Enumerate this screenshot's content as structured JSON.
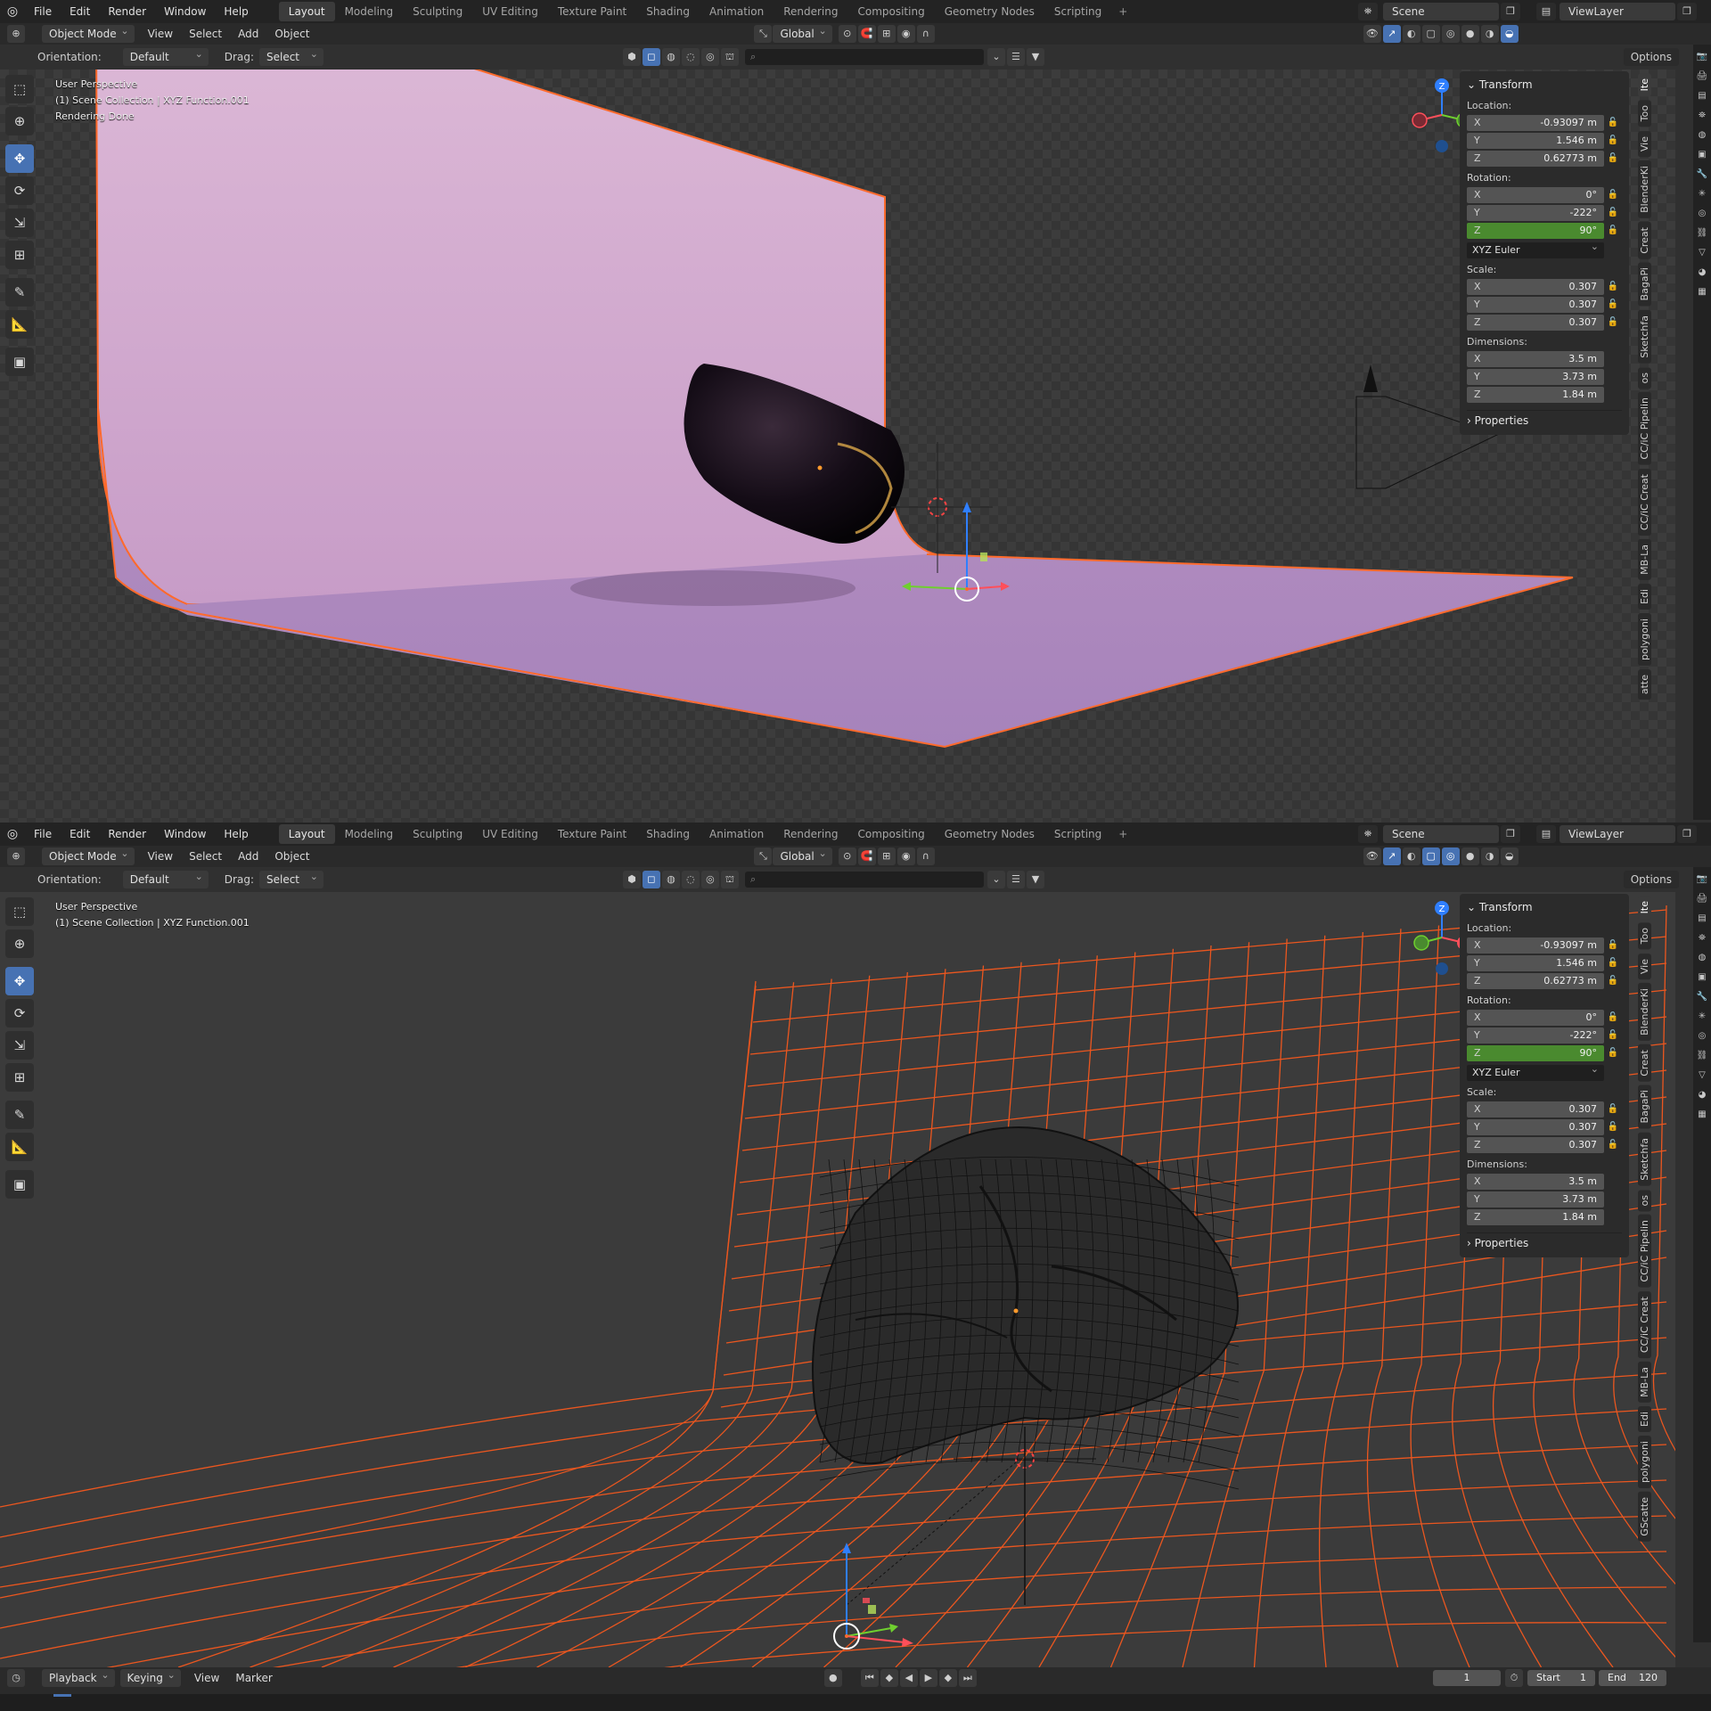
{
  "header": {
    "menus": [
      "File",
      "Edit",
      "Render",
      "Window",
      "Help"
    ],
    "workspaces": [
      "Layout",
      "Modeling",
      "Sculpting",
      "UV Editing",
      "Texture Paint",
      "Shading",
      "Animation",
      "Rendering",
      "Compositing",
      "Geometry Nodes",
      "Scripting"
    ],
    "add_tab": "+",
    "scene": "Scene",
    "view_layer": "ViewLayer"
  },
  "editor_header": {
    "mode": "Object Mode",
    "menus": [
      "View",
      "Select",
      "Add",
      "Object"
    ],
    "transform_orientation": "Global"
  },
  "tool_settings": {
    "orientation_label": "Orientation:",
    "orientation_value": "Default",
    "drag_label": "Drag:",
    "drag_value": "Select Box",
    "options": "Options"
  },
  "viewport_top": {
    "info": [
      "User Perspective",
      "(1) Scene Collection | XYZ Function.001",
      "Rendering Done"
    ]
  },
  "viewport_bottom": {
    "info": [
      "User Perspective",
      "(1) Scene Collection | XYZ Function.001"
    ]
  },
  "gizmo_axes": {
    "x": "X",
    "y": "Y",
    "z": "Z"
  },
  "transform": {
    "title": "Transform",
    "location_label": "Location:",
    "location": [
      {
        "axis": "X",
        "value": "-0.93097 m"
      },
      {
        "axis": "Y",
        "value": "1.546 m"
      },
      {
        "axis": "Z",
        "value": "0.62773 m"
      }
    ],
    "rotation_label": "Rotation:",
    "rotation": [
      {
        "axis": "X",
        "value": "0°"
      },
      {
        "axis": "Y",
        "value": "-222°"
      },
      {
        "axis": "Z",
        "value": "90°"
      }
    ],
    "rotation_mode": "XYZ Euler",
    "scale_label": "Scale:",
    "scale": [
      {
        "axis": "X",
        "value": "0.307"
      },
      {
        "axis": "Y",
        "value": "0.307"
      },
      {
        "axis": "Z",
        "value": "0.307"
      }
    ],
    "dimensions_label": "Dimensions:",
    "dimensions": [
      {
        "axis": "X",
        "value": "3.5 m"
      },
      {
        "axis": "Y",
        "value": "3.73 m"
      },
      {
        "axis": "Z",
        "value": "1.84 m"
      }
    ],
    "properties": "Properties"
  },
  "side_tabs": [
    "Ite",
    "Too",
    "Vie",
    "BlenderKi",
    "Creat",
    "BagaPi",
    "Sketchfa",
    "os",
    "CC/iC Pipelin",
    "CC/iC Creat",
    "MB-La",
    "Edi",
    "polygoni",
    "atte"
  ],
  "side_tabs_bottom": [
    "Ite",
    "Too",
    "Vie",
    "BlenderKi",
    "Creat",
    "BagaPi",
    "Sketchfa",
    "os",
    "CC/iC Pipelin",
    "CC/iC Creat",
    "MB-La",
    "Edi",
    "polygoni",
    "GScatte"
  ],
  "timeline": {
    "menus": [
      "Playback",
      "Keying",
      "View",
      "Marker"
    ],
    "current_frame": "1",
    "start_label": "Start",
    "start": "1",
    "end_label": "End",
    "end": "120"
  },
  "colors": {
    "accent": "#4772b3",
    "rotation_z_active": "#4a8a2f",
    "selection_outline": "#ff6a2c",
    "backdrop": "#d9b4d3"
  }
}
